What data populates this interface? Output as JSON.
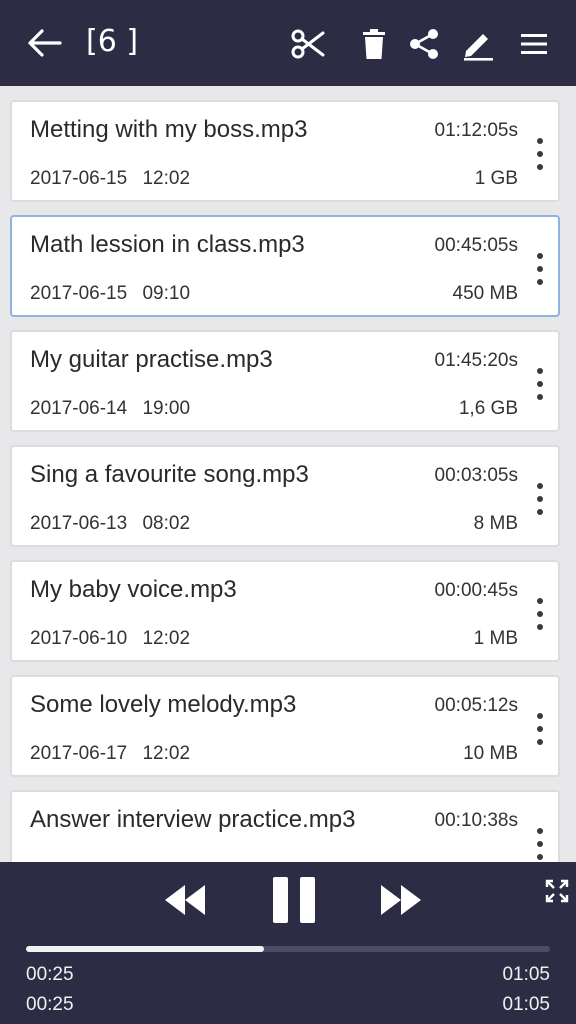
{
  "header": {
    "count_label": "[6 ]",
    "icons": [
      "back-arrow-icon",
      "scissors-icon",
      "trash-icon",
      "share-icon",
      "pencil-icon",
      "menu-icon"
    ]
  },
  "recordings": [
    {
      "name": "Metting with my boss.mp3",
      "duration": "01:12:05s",
      "date": "2017-06-15  12:02",
      "size": "1 GB",
      "selected": false
    },
    {
      "name": "Math lession in class.mp3",
      "duration": "00:45:05s",
      "date": "2017-06-15  09:10",
      "size": "450 MB",
      "selected": true
    },
    {
      "name": "My guitar practise.mp3",
      "duration": "01:45:20s",
      "date": "2017-06-14  19:00",
      "size": "1,6 GB",
      "selected": false
    },
    {
      "name": "Sing a favourite song.mp3",
      "duration": "00:03:05s",
      "date": "2017-06-13  08:02",
      "size": "8 MB",
      "selected": false
    },
    {
      "name": "My baby voice.mp3",
      "duration": "00:00:45s",
      "date": "2017-06-10  12:02",
      "size": "1 MB",
      "selected": false
    },
    {
      "name": "Some lovely melody.mp3",
      "duration": "00:05:12s",
      "date": "2017-06-17  12:02",
      "size": "10 MB",
      "selected": false
    },
    {
      "name": "Answer interview practice.mp3",
      "duration": "00:10:38s",
      "date": "",
      "size": "",
      "selected": false
    }
  ],
  "player": {
    "progress": 0.455,
    "elapsed": "00:25",
    "total": "01:05",
    "elapsed_2": "00:25",
    "total_2": "01:05",
    "icons": [
      "rewind-icon",
      "pause-icon",
      "fast-forward-icon",
      "fullscreen-icon"
    ]
  },
  "colors": {
    "bar_bg": "#2c2d45",
    "list_bg": "#e8e8ea",
    "selected_border": "#8fb3e0"
  }
}
